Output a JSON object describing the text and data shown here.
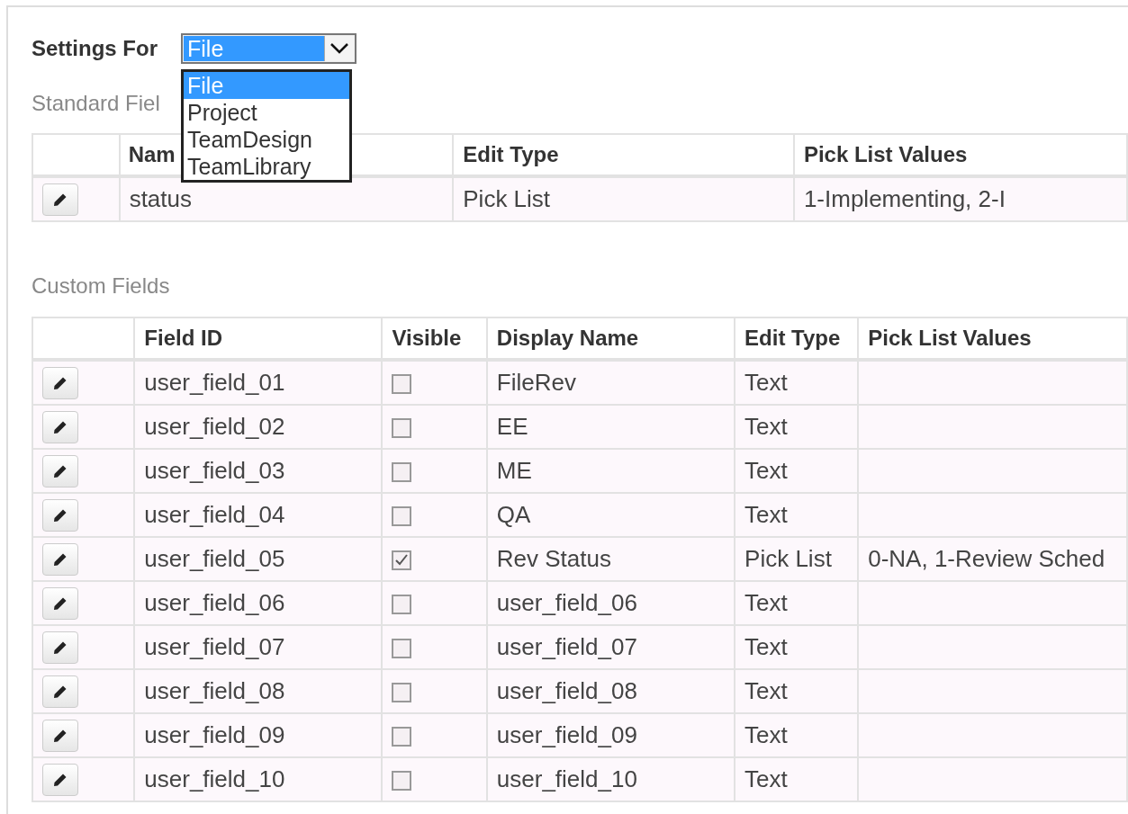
{
  "settings_for": {
    "label": "Settings For",
    "value": "File",
    "expanded": true,
    "options": [
      {
        "label": "File",
        "selected": true
      },
      {
        "label": "Project",
        "selected": false
      },
      {
        "label": "TeamDesign",
        "selected": false
      },
      {
        "label": "TeamLibrary",
        "selected": false
      }
    ]
  },
  "standard_fields": {
    "title": "Standard Fiel",
    "columns": [
      "Nam",
      "Edit Type",
      "Pick List Values"
    ],
    "rows": [
      {
        "name": "status",
        "edit_type": "Pick List",
        "pick_list_values": "1-Implementing, 2-I"
      }
    ]
  },
  "custom_fields": {
    "title": "Custom Fields",
    "columns": [
      "Field ID",
      "Visible",
      "Display Name",
      "Edit Type",
      "Pick List Values"
    ],
    "rows": [
      {
        "field_id": "user_field_01",
        "visible": false,
        "display_name": "FileRev",
        "edit_type": "Text"
      },
      {
        "field_id": "user_field_02",
        "visible": false,
        "display_name": "EE",
        "edit_type": "Text"
      },
      {
        "field_id": "user_field_03",
        "visible": false,
        "display_name": "ME",
        "edit_type": "Text"
      },
      {
        "field_id": "user_field_04",
        "visible": false,
        "display_name": "QA",
        "edit_type": "Text"
      },
      {
        "field_id": "user_field_05",
        "visible": true,
        "display_name": "Rev Status",
        "edit_type": "Pick List",
        "pick_list_values": "0-NA, 1-Review Sched"
      },
      {
        "field_id": "user_field_06",
        "visible": false,
        "display_name": "user_field_06",
        "edit_type": "Text"
      },
      {
        "field_id": "user_field_07",
        "visible": false,
        "display_name": "user_field_07",
        "edit_type": "Text"
      },
      {
        "field_id": "user_field_08",
        "visible": false,
        "display_name": "user_field_08",
        "edit_type": "Text"
      },
      {
        "field_id": "user_field_09",
        "visible": false,
        "display_name": "user_field_09",
        "edit_type": "Text"
      },
      {
        "field_id": "user_field_10",
        "visible": false,
        "display_name": "user_field_10",
        "edit_type": "Text"
      }
    ]
  }
}
